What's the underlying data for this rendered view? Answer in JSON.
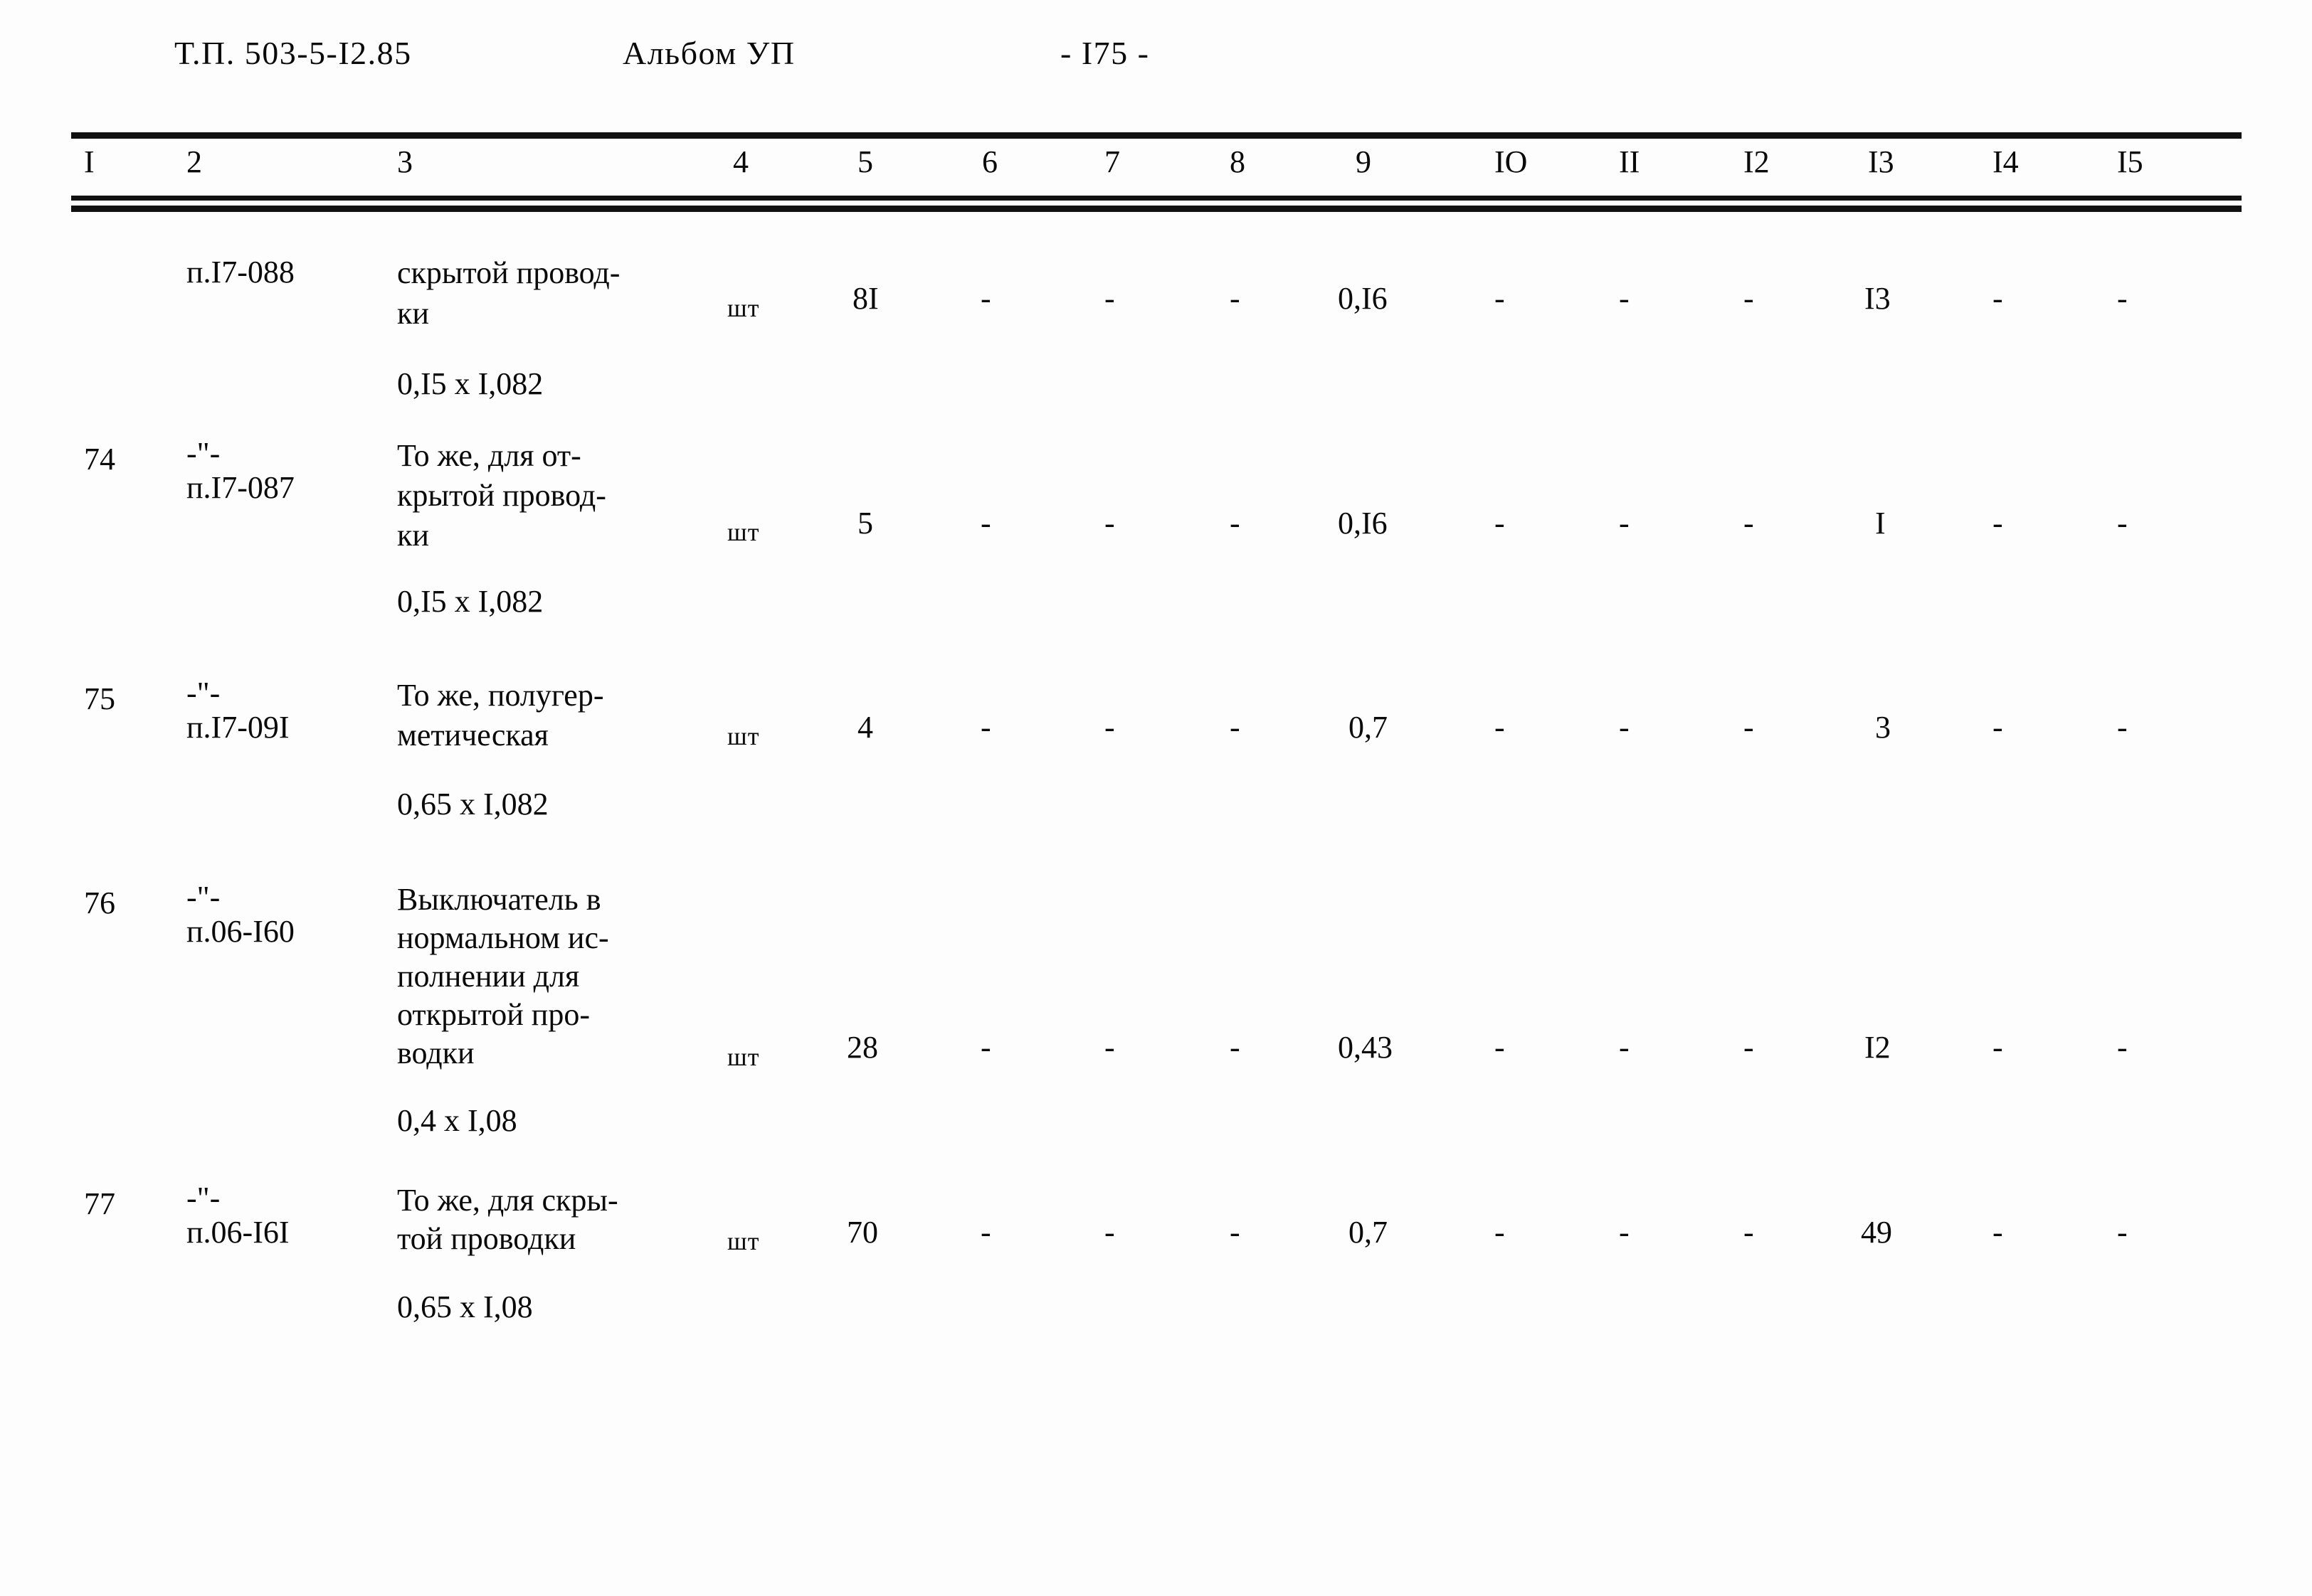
{
  "header": {
    "code": "Т.П. 503-5-I2.85",
    "album": "Альбом УП",
    "page": "- I75 -"
  },
  "table": {
    "column_headers": [
      "I",
      "2",
      "3",
      "4",
      "5",
      "6",
      "7",
      "8",
      "9",
      "IO",
      "II",
      "I2",
      "I3",
      "I4",
      "I5"
    ],
    "rows": [
      {
        "num": "",
        "code_ditto": "",
        "code": "п.I7-088",
        "desc_lines": [
          "скрытой провод-",
          "ки"
        ],
        "dims": "0,I5 x I,082",
        "unit": "шт",
        "c5": "8I",
        "c6": "-",
        "c7": "-",
        "c8": "-",
        "c9": "0,I6",
        "c10": "-",
        "c11": "-",
        "c12": "-",
        "c13": "I3",
        "c14": "-",
        "c15": "-"
      },
      {
        "num": "74",
        "code_ditto": "-\"-",
        "code": "п.I7-087",
        "desc_lines": [
          "То же, для от-",
          "крытой провод-",
          "ки"
        ],
        "dims": "0,I5 x I,082",
        "unit": "шт",
        "c5": "5",
        "c6": "-",
        "c7": "-",
        "c8": "-",
        "c9": "0,I6",
        "c10": "-",
        "c11": "-",
        "c12": "-",
        "c13": "I",
        "c14": "-",
        "c15": "-"
      },
      {
        "num": "75",
        "code_ditto": "-\"-",
        "code": "п.I7-09I",
        "desc_lines": [
          "То же, полугер-",
          "метическая"
        ],
        "dims": "0,65 x I,082",
        "unit": "шт",
        "c5": "4",
        "c6": "-",
        "c7": "-",
        "c8": "-",
        "c9": "0,7",
        "c10": "-",
        "c11": "-",
        "c12": "-",
        "c13": "3",
        "c14": "-",
        "c15": "-"
      },
      {
        "num": "76",
        "code_ditto": "-\"-",
        "code": "п.06-I60",
        "desc_lines": [
          "Выключатель в",
          "нормальном ис-",
          "полнении для",
          "открытой про-",
          "водки"
        ],
        "dims": "0,4 x I,08",
        "unit": "шт",
        "c5": "28",
        "c6": "-",
        "c7": "-",
        "c8": "-",
        "c9": "0,43",
        "c10": "-",
        "c11": "-",
        "c12": "-",
        "c13": "I2",
        "c14": "-",
        "c15": "-"
      },
      {
        "num": "77",
        "code_ditto": "-\"-",
        "code": "п.06-I6I",
        "desc_lines": [
          "То же, для скры-",
          "той проводки"
        ],
        "dims": "0,65 x I,08",
        "unit": "шт",
        "c5": "70",
        "c6": "-",
        "c7": "-",
        "c8": "-",
        "c9": "0,7",
        "c10": "-",
        "c11": "-",
        "c12": "-",
        "c13": "49",
        "c14": "-",
        "c15": "-"
      }
    ]
  }
}
